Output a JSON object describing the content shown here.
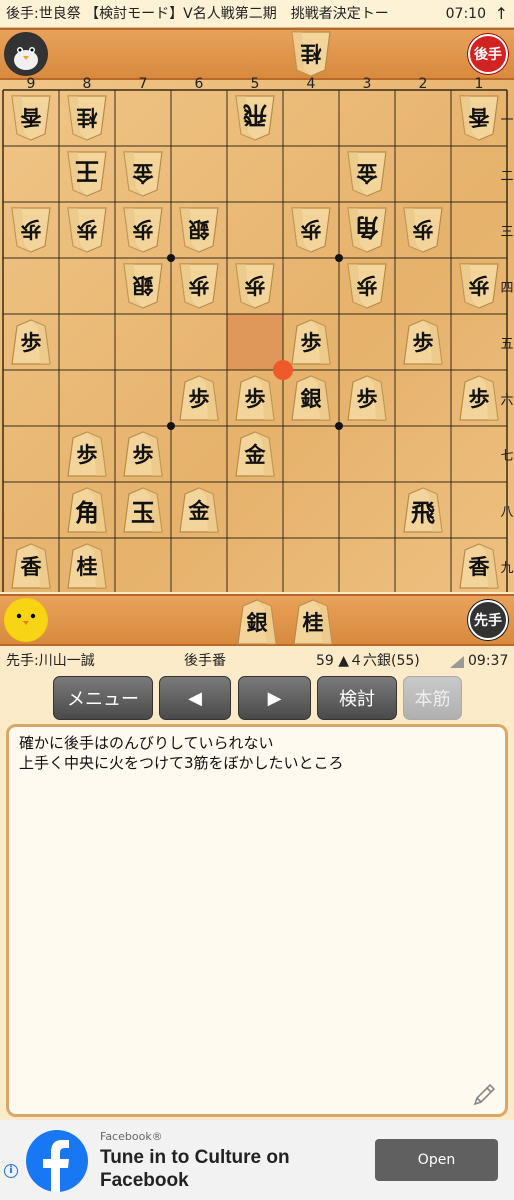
{
  "top_bar": {
    "title": "後手:世良祭 【検討モード】V名人戦第二期　挑戦者決定トー",
    "clock": "07:10",
    "arrow": "↑"
  },
  "gote_stand": {
    "pieces": [
      "桂"
    ],
    "turn_label": "後手"
  },
  "sente_stand": {
    "pieces": [
      "銀",
      "桂"
    ],
    "turn_label": "先手"
  },
  "board": {
    "file_labels": [
      "9",
      "8",
      "7",
      "6",
      "5",
      "4",
      "3",
      "2",
      "1"
    ],
    "rank_labels": [
      "一",
      "二",
      "三",
      "四",
      "五",
      "六",
      "七",
      "八",
      "九"
    ],
    "highlight_square": {
      "file": 5,
      "rank": 5
    },
    "last_move_marker": {
      "file": 4,
      "rank": 6
    },
    "pieces": [
      {
        "file": 9,
        "rank": 1,
        "char": "香",
        "owner": "gote"
      },
      {
        "file": 8,
        "rank": 1,
        "char": "桂",
        "owner": "gote"
      },
      {
        "file": 5,
        "rank": 1,
        "char": "飛",
        "owner": "gote",
        "big": true
      },
      {
        "file": 1,
        "rank": 1,
        "char": "香",
        "owner": "gote"
      },
      {
        "file": 8,
        "rank": 2,
        "char": "王",
        "owner": "gote",
        "big": true
      },
      {
        "file": 7,
        "rank": 2,
        "char": "金",
        "owner": "gote"
      },
      {
        "file": 3,
        "rank": 2,
        "char": "金",
        "owner": "gote"
      },
      {
        "file": 9,
        "rank": 3,
        "char": "歩",
        "owner": "gote"
      },
      {
        "file": 8,
        "rank": 3,
        "char": "歩",
        "owner": "gote"
      },
      {
        "file": 7,
        "rank": 3,
        "char": "歩",
        "owner": "gote"
      },
      {
        "file": 6,
        "rank": 3,
        "char": "銀",
        "owner": "gote"
      },
      {
        "file": 4,
        "rank": 3,
        "char": "歩",
        "owner": "gote"
      },
      {
        "file": 3,
        "rank": 3,
        "char": "角",
        "owner": "gote",
        "big": true
      },
      {
        "file": 2,
        "rank": 3,
        "char": "歩",
        "owner": "gote"
      },
      {
        "file": 7,
        "rank": 4,
        "char": "銀",
        "owner": "gote"
      },
      {
        "file": 6,
        "rank": 4,
        "char": "歩",
        "owner": "gote"
      },
      {
        "file": 5,
        "rank": 4,
        "char": "歩",
        "owner": "gote"
      },
      {
        "file": 3,
        "rank": 4,
        "char": "歩",
        "owner": "gote"
      },
      {
        "file": 1,
        "rank": 4,
        "char": "歩",
        "owner": "gote"
      },
      {
        "file": 9,
        "rank": 5,
        "char": "歩",
        "owner": "sente"
      },
      {
        "file": 4,
        "rank": 5,
        "char": "歩",
        "owner": "sente"
      },
      {
        "file": 2,
        "rank": 5,
        "char": "歩",
        "owner": "sente"
      },
      {
        "file": 6,
        "rank": 6,
        "char": "歩",
        "owner": "sente"
      },
      {
        "file": 5,
        "rank": 6,
        "char": "歩",
        "owner": "sente"
      },
      {
        "file": 4,
        "rank": 6,
        "char": "銀",
        "owner": "sente"
      },
      {
        "file": 3,
        "rank": 6,
        "char": "歩",
        "owner": "sente"
      },
      {
        "file": 1,
        "rank": 6,
        "char": "歩",
        "owner": "sente"
      },
      {
        "file": 8,
        "rank": 7,
        "char": "歩",
        "owner": "sente"
      },
      {
        "file": 7,
        "rank": 7,
        "char": "歩",
        "owner": "sente"
      },
      {
        "file": 5,
        "rank": 7,
        "char": "金",
        "owner": "sente"
      },
      {
        "file": 8,
        "rank": 8,
        "char": "角",
        "owner": "sente",
        "big": true
      },
      {
        "file": 7,
        "rank": 8,
        "char": "玉",
        "owner": "sente",
        "big": true
      },
      {
        "file": 6,
        "rank": 8,
        "char": "金",
        "owner": "sente"
      },
      {
        "file": 2,
        "rank": 8,
        "char": "飛",
        "owner": "sente",
        "big": true
      },
      {
        "file": 9,
        "rank": 9,
        "char": "香",
        "owner": "sente"
      },
      {
        "file": 8,
        "rank": 9,
        "char": "桂",
        "owner": "sente"
      },
      {
        "file": 1,
        "rank": 9,
        "char": "香",
        "owner": "sente"
      }
    ]
  },
  "info_bar": {
    "sente_player": "先手:川山一誠",
    "turn": "後手番",
    "move": "59 ▲４六銀(55)",
    "time": "09:37"
  },
  "buttons": {
    "menu": "メニュー",
    "prev": "◀",
    "next": "▶",
    "analyze": "検討",
    "mainline": "本筋"
  },
  "comment": {
    "line1": "確かに後手はのんびりしていられない",
    "line2": "上手く中央に火をつけて3筋をぼかしたいところ"
  },
  "ad": {
    "source": "Facebook®",
    "headline": "Tune in to Culture on Facebook",
    "cta": "Open",
    "info_icon": "i"
  },
  "colors": {
    "board": "#e9b775",
    "highlight": "#e0975a",
    "marker": "#ee5a2a"
  }
}
